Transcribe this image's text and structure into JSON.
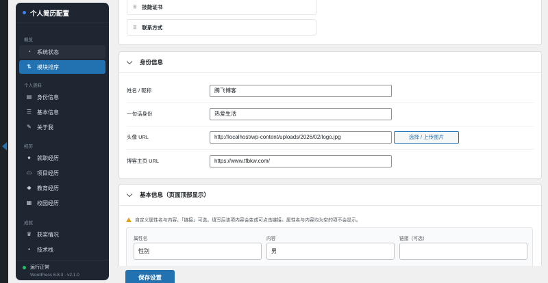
{
  "sidebar": {
    "title": "个人简历配置",
    "groups": [
      {
        "label": "概览"
      },
      {
        "label": "个人资料"
      },
      {
        "label": "经历"
      },
      {
        "label": "成就"
      }
    ],
    "items": [
      {
        "label": "系统状态",
        "icon": "dashboard-icon"
      },
      {
        "label": "模块排序",
        "icon": "sort-icon"
      },
      {
        "label": "身份信息",
        "icon": "id-card-icon"
      },
      {
        "label": "基本信息",
        "icon": "list-icon"
      },
      {
        "label": "关于我",
        "icon": "edit-icon"
      },
      {
        "label": "就职经历",
        "icon": "user-icon"
      },
      {
        "label": "项目经历",
        "icon": "folder-icon"
      },
      {
        "label": "教育经历",
        "icon": "graduation-icon"
      },
      {
        "label": "校园经历",
        "icon": "school-icon"
      },
      {
        "label": "获奖情况",
        "icon": "award-icon"
      },
      {
        "label": "技术栈",
        "icon": "grid-icon"
      }
    ],
    "status": "运行正常",
    "version": "WordPress 6.8.3 · v2.1.0"
  },
  "module_sort": {
    "items": [
      "技能证书",
      "联系方式"
    ]
  },
  "identity": {
    "title": "身份信息",
    "fields": [
      {
        "label": "姓名 / 昵称",
        "value": "腾飞博客"
      },
      {
        "label": "一句话身份",
        "value": "热爱生活"
      },
      {
        "label": "头像 URL",
        "value": "http://localhost/wp-content/uploads/2026/02/logo.jpg"
      },
      {
        "label": "博客主页 URL",
        "value": "https://www.tfbkw.com/"
      }
    ],
    "upload_button": "选择 / 上传图片"
  },
  "basic_info": {
    "title": "基本信息（页面顶部显示）",
    "notice": "自定义属性名与内容，「链接」可选。填写后该项内容会变成可点击链接。属性名与内容均为空的项不会显示。",
    "columns": [
      "属性名",
      "内容",
      "链接（可选）"
    ],
    "row": {
      "name": "性别",
      "content": "男",
      "link": ""
    }
  },
  "save_button": "保存设置",
  "colors": {
    "accent": "#2271b1",
    "sidebar_bg": "#1e2632",
    "status_ok": "#22c55e",
    "warning": "#dba617"
  }
}
